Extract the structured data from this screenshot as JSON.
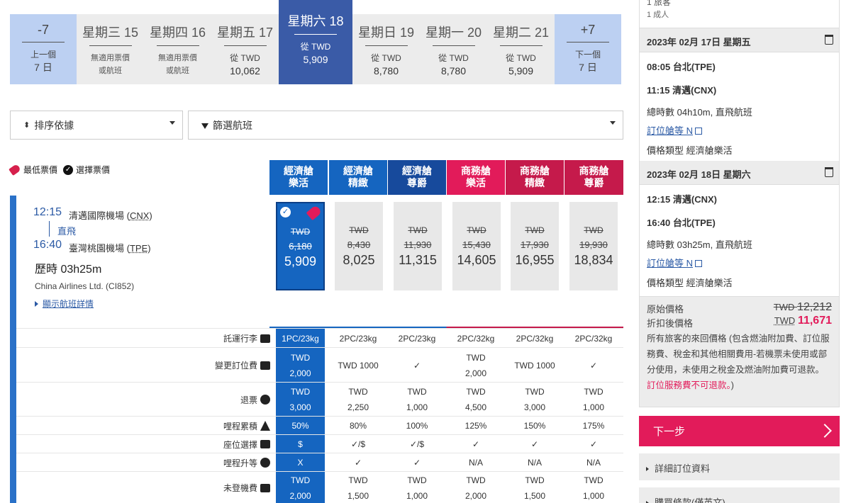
{
  "date_strip": {
    "prev": {
      "name": "-7",
      "l1": "上一個",
      "l2": "7 日"
    },
    "days": [
      {
        "name": "星期三 15",
        "l1": "無適用票價",
        "l2": "或航班",
        "type": "na"
      },
      {
        "name": "星期四 16",
        "l1": "無適用票價",
        "l2": "或航班",
        "type": "na"
      },
      {
        "name": "星期五 17",
        "l1": "從 TWD",
        "l2": "10,062",
        "type": "price"
      },
      {
        "name": "星期六 18",
        "l1": "從 TWD",
        "l2": "5,909",
        "type": "selected"
      },
      {
        "name": "星期日 19",
        "l1": "從 TWD",
        "l2": "8,780",
        "type": "price"
      },
      {
        "name": "星期一 20",
        "l1": "從 TWD",
        "l2": "8,780",
        "type": "price"
      },
      {
        "name": "星期二 21",
        "l1": "從 TWD",
        "l2": "5,909",
        "type": "price"
      }
    ],
    "next": {
      "name": "+7",
      "l1": "下一個",
      "l2": "7 日"
    }
  },
  "sort": {
    "label": "排序依據"
  },
  "filter": {
    "label": "篩選航班"
  },
  "legend": {
    "lowest": "最低票價",
    "selected": "選擇票價"
  },
  "cabins": [
    {
      "l1": "經濟艙",
      "l2": "樂活"
    },
    {
      "l1": "經濟艙",
      "l2": "精緻"
    },
    {
      "l1": "經濟艙",
      "l2": "尊爵"
    },
    {
      "l1": "商務艙",
      "l2": "樂活"
    },
    {
      "l1": "商務艙",
      "l2": "精緻"
    },
    {
      "l1": "商務艙",
      "l2": "尊爵"
    }
  ],
  "flight": {
    "dep_time": "12:15",
    "dep_airport": "清邁國際機場",
    "dep_code": "CNX",
    "direct": "直飛",
    "arr_time": "16:40",
    "arr_airport": "臺灣桃園機場",
    "arr_code": "TPE",
    "duration": "歷時 03h25m",
    "airline": "China Airlines Ltd. (CI852)",
    "details_link": "顯示航班詳情"
  },
  "fares": [
    {
      "cur": "TWD",
      "orig": "6,180",
      "disc": "5,909"
    },
    {
      "cur": "TWD",
      "orig": "8,430",
      "disc": "8,025"
    },
    {
      "cur": "TWD",
      "orig": "11,930",
      "disc": "11,315"
    },
    {
      "cur": "TWD",
      "orig": "15,430",
      "disc": "14,605"
    },
    {
      "cur": "TWD",
      "orig": "17,930",
      "disc": "16,955"
    },
    {
      "cur": "TWD",
      "orig": "19,930",
      "disc": "18,834"
    }
  ],
  "features": [
    {
      "label": "託運行李",
      "icon": "suitcase-icon",
      "cells": [
        [
          "1PC/23kg"
        ],
        [
          "2PC/23kg"
        ],
        [
          "2PC/23kg"
        ],
        [
          "2PC/32kg"
        ],
        [
          "2PC/32kg"
        ],
        [
          "2PC/32kg"
        ]
      ]
    },
    {
      "label": "變更訂位費",
      "icon": "refresh-icon",
      "cells": [
        [
          "TWD",
          "2,000"
        ],
        [
          "TWD 1000"
        ],
        [
          "✓"
        ],
        [
          "TWD",
          "2,000"
        ],
        [
          "TWD 1000"
        ],
        [
          "✓"
        ]
      ]
    },
    {
      "label": "退票",
      "icon": "refund-icon",
      "cells": [
        [
          "TWD",
          "3,000"
        ],
        [
          "TWD",
          "2,250"
        ],
        [
          "TWD",
          "1,000"
        ],
        [
          "TWD",
          "4,500"
        ],
        [
          "TWD",
          "3,000"
        ],
        [
          "TWD",
          "1,000"
        ]
      ]
    },
    {
      "label": "哩程累積",
      "icon": "plane-icon",
      "cells": [
        [
          "50%"
        ],
        [
          "80%"
        ],
        [
          "100%"
        ],
        [
          "125%"
        ],
        [
          "150%"
        ],
        [
          "175%"
        ]
      ]
    },
    {
      "label": "座位選擇",
      "icon": "seat-icon",
      "cells": [
        [
          "$"
        ],
        [
          "✓/$"
        ],
        [
          "✓/$"
        ],
        [
          "✓"
        ],
        [
          "✓"
        ],
        [
          "✓"
        ]
      ]
    },
    {
      "label": "哩程升等",
      "icon": "upgrade-icon",
      "cells": [
        [
          "X"
        ],
        [
          "✓"
        ],
        [
          "✓"
        ],
        [
          "N/A"
        ],
        [
          "N/A"
        ],
        [
          "N/A"
        ]
      ]
    },
    {
      "label": "未登機費",
      "icon": "person-icon",
      "cells": [
        [
          "TWD",
          "2,000"
        ],
        [
          "TWD",
          "1,500"
        ],
        [
          "TWD",
          "1,000"
        ],
        [
          "TWD",
          "2,000"
        ],
        [
          "TWD",
          "1,500"
        ],
        [
          "TWD",
          "1,000"
        ]
      ]
    }
  ],
  "summary": {
    "passengers_cut": "1 旅客",
    "passengers": "1 成人",
    "segments": [
      {
        "date": "2023年 02月 17日 星期五",
        "dep": "08:05 台北(TPE)",
        "arr": "11:15 清邁(CNX)",
        "info": "總時數 04h10m, 直飛航班",
        "class_link": "訂位艙等 N",
        "fare_type": "價格類型 經濟艙樂活"
      },
      {
        "date": "2023年 02月 18日 星期六",
        "dep": "12:15 清邁(CNX)",
        "arr": "16:40 台北(TPE)",
        "info": "總時數 03h25m, 直飛航班",
        "class_link": "訂位艙等 N",
        "fare_type": "價格類型 經濟艙樂活"
      }
    ],
    "orig_label": "原始價格",
    "orig_cur": "TWD",
    "orig_value": "12,212",
    "disc_label": "折扣後價格",
    "disc_cur": "TWD",
    "disc_value": "11,671",
    "note": "所有旅客的來回價格 (包含燃油附加費、訂位服務費、稅金和其他相關費用-若機票未使用或部分使用，未使用之稅金及燃油附加費可退款。",
    "note_pink": "訂位服務費不可退款。",
    "note_end": ")"
  },
  "next_button": "下一步",
  "accordions": [
    "詳細訂位資料",
    "購買條款(僅英文)"
  ]
}
